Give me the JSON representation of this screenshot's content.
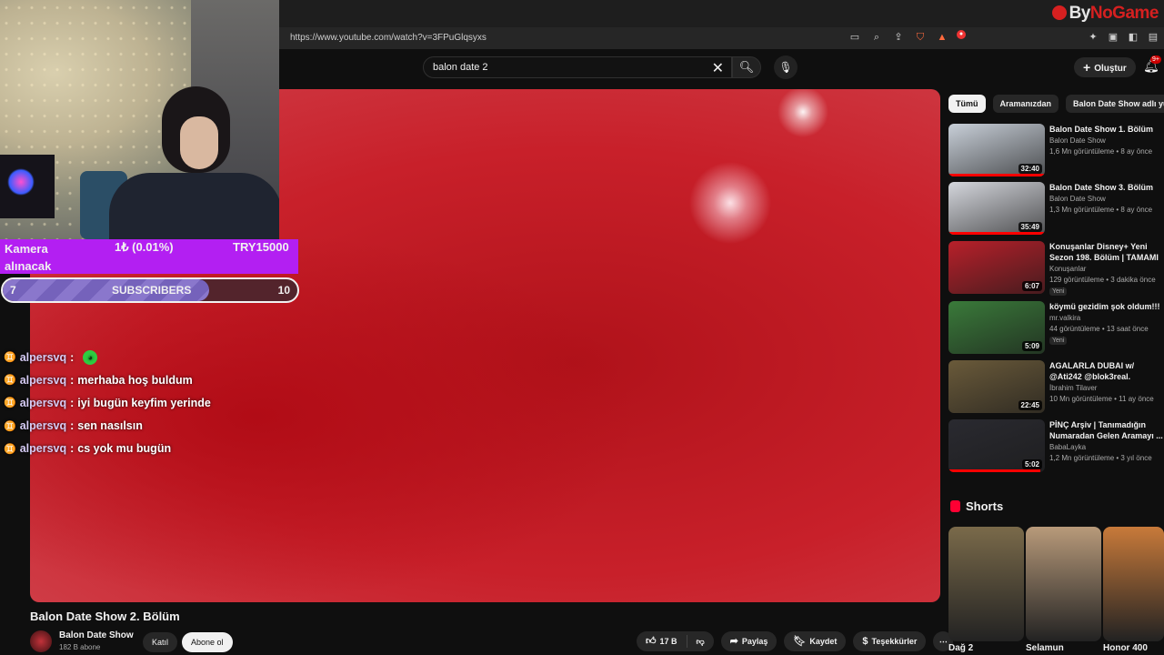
{
  "watermark": {
    "by": "By",
    "game": "NoGame"
  },
  "browser": {
    "url": "https://www.youtube.com/watch?v=3FPuGlqsyxs"
  },
  "masthead": {
    "search_value": "balon date 2",
    "create_label": "Oluştur",
    "notif_badge": "9+"
  },
  "video": {
    "title": "Balon Date Show 2. Bölüm",
    "channel": "Balon Date Show",
    "subscribers": "182 B abone",
    "join_label": "Katıl",
    "subscribe_label": "Abone ol",
    "likes": "17 B",
    "share_label": "Paylaş",
    "save_label": "Kaydet",
    "thanks_label": "Teşekkürler"
  },
  "sidebar": {
    "chips": [
      "Tümü",
      "Aramanızdan",
      "Balon Date Show adlı yü"
    ],
    "recommendations": [
      {
        "title": "Balon Date Show 1. Bölüm",
        "channel": "Balon Date Show",
        "stats": "1,6 Mn görüntüleme • 8 ay önce",
        "duration": "32:40",
        "progress": 1.0,
        "color": "#c8cfd8"
      },
      {
        "title": "Balon Date Show 3. Bölüm",
        "channel": "Balon Date Show",
        "stats": "1,3 Mn görüntüleme • 8 ay önce",
        "duration": "35:49",
        "progress": 1.0,
        "color": "#d4d6dc"
      },
      {
        "title": "Konuşanlar Disney+ Yeni Sezon 198. Bölüm | TAMAMI ...",
        "channel": "Konuşanlar",
        "stats": "129 görüntüleme • 3 dakika önce",
        "duration": "6:07",
        "badge": "Yeni",
        "progress": 0,
        "color": "#b8202a"
      },
      {
        "title": "köymü gezidim şok oldum!!!",
        "channel": "mr.valkira",
        "stats": "44 görüntüleme • 13 saat önce",
        "duration": "5:09",
        "badge": "Yeni",
        "progress": 0,
        "color": "#3a7a3a"
      },
      {
        "title": "AGALARLA DUBAI w/ @Ati242 @blok3real.",
        "channel": "İbrahim Tilaver",
        "stats": "10 Mn görüntüleme • 11 ay önce",
        "duration": "22:45",
        "progress": 0,
        "color": "#6a5a3a"
      },
      {
        "title": "PİNÇ Arşiv | Tanımadığın Numaradan Gelen Aramayı ...",
        "channel": "BabaLayka",
        "stats": "1,2 Mn görüntüleme • 3 yıl önce",
        "duration": "5:02",
        "progress": 0.95,
        "color": "#2a2a30"
      }
    ],
    "shorts_heading": "Shorts",
    "shorts": [
      {
        "title": "Dağ 2",
        "color": "#7a6a4a"
      },
      {
        "title": "Selamun",
        "color": "#b89a7a"
      },
      {
        "title": "Honor 400",
        "color": "#c87a3a"
      }
    ]
  },
  "overlay": {
    "goal_name": "Kamera alınacak",
    "goal_progress": "1₺ (0.01%)",
    "goal_target": "TRY15000",
    "subs_current": "7",
    "subs_label": "SUBSCRIBERS",
    "subs_goal": "10",
    "subs_fraction": 0.7,
    "chat": [
      {
        "user": "alpersvq",
        "msg": "",
        "emote": true
      },
      {
        "user": "alpersvq",
        "msg": "merhaba hoş buldum"
      },
      {
        "user": "alpersvq",
        "msg": "iyi bugün keyfim yerinde"
      },
      {
        "user": "alpersvq",
        "msg": "sen nasılsın"
      },
      {
        "user": "alpersvq",
        "msg": "cs yok mu bugün"
      }
    ]
  }
}
